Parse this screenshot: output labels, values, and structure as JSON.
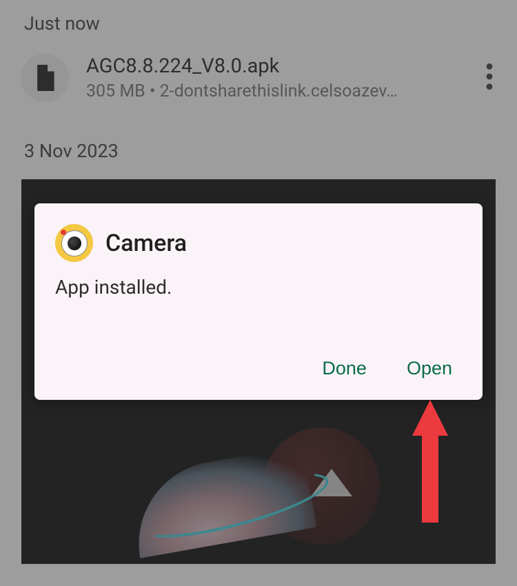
{
  "sections": {
    "recent": {
      "header": "Just now",
      "file": {
        "name": "AGC8.8.224_V8.0.apk",
        "size": "305 MB",
        "source": "2-dontsharethislink.celsoazev…"
      }
    },
    "older": {
      "header": "3 Nov 2023"
    }
  },
  "dialog": {
    "app_name": "Camera",
    "message": "App installed.",
    "done_label": "Done",
    "open_label": "Open"
  },
  "colors": {
    "accent": "#0a6b4a",
    "dialog_bg": "#faf3f8",
    "arrow": "#ec3a3f"
  }
}
